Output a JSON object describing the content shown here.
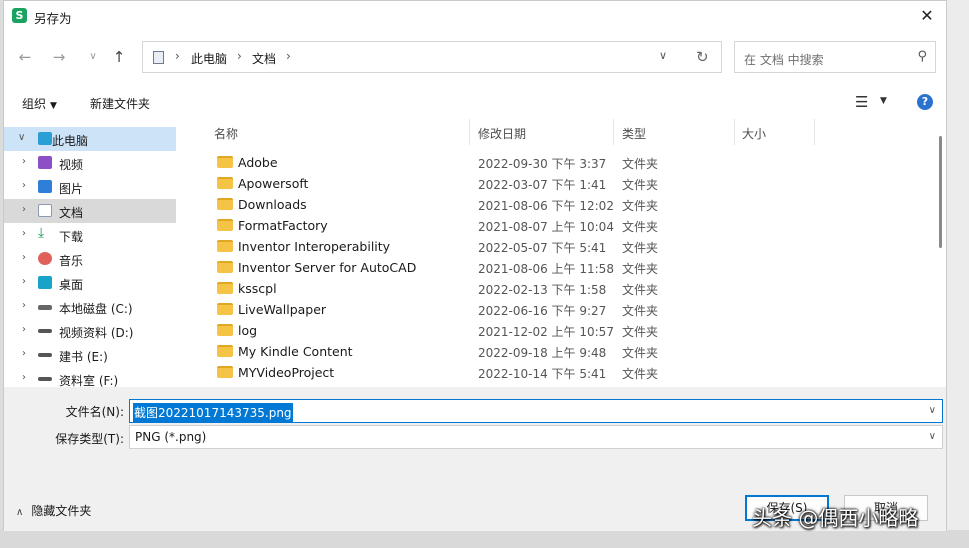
{
  "window": {
    "title": "另存为",
    "app_icon_glyph": "S",
    "close_glyph": "✕"
  },
  "address": {
    "crumbs": [
      "此电脑",
      "文档"
    ],
    "search_placeholder": "在 文档 中搜索"
  },
  "toolbar": {
    "organize_label": "组织",
    "new_folder_label": "新建文件夹"
  },
  "tree": {
    "items": [
      {
        "label": "此电脑",
        "icon": "computer-icon",
        "color": "#2a9fd6"
      },
      {
        "label": "视频",
        "icon": "video-icon",
        "color": "#8e4ec6"
      },
      {
        "label": "图片",
        "icon": "picture-icon",
        "color": "#2f7ed8"
      },
      {
        "label": "文档",
        "icon": "document-icon",
        "color": "#8a9bb2"
      },
      {
        "label": "下载",
        "icon": "download-icon",
        "color": "#1a9e5a"
      },
      {
        "label": "音乐",
        "icon": "music-icon",
        "color": "#e0605a"
      },
      {
        "label": "桌面",
        "icon": "desktop-icon",
        "color": "#19a3c9"
      },
      {
        "label": "本地磁盘 (C:)",
        "icon": "drive-icon",
        "color": "#555555"
      },
      {
        "label": "视频资料 (D:)",
        "icon": "drive-icon",
        "color": "#555555"
      },
      {
        "label": "建书 (E:)",
        "icon": "drive-icon",
        "color": "#555555"
      },
      {
        "label": "资料室 (F:)",
        "icon": "drive-icon",
        "color": "#555555"
      }
    ]
  },
  "columns": {
    "name": "名称",
    "modified": "修改日期",
    "type": "类型",
    "size": "大小"
  },
  "files": [
    {
      "name": "Adobe",
      "date": "2022-09-30 下午 3:37",
      "type": "文件夹"
    },
    {
      "name": "Apowersoft",
      "date": "2022-03-07 下午 1:41",
      "type": "文件夹"
    },
    {
      "name": "Downloads",
      "date": "2021-08-06 下午 12:02",
      "type": "文件夹"
    },
    {
      "name": "FormatFactory",
      "date": "2021-08-07 上午 10:04",
      "type": "文件夹"
    },
    {
      "name": "Inventor Interoperability",
      "date": "2022-05-07 下午 5:41",
      "type": "文件夹"
    },
    {
      "name": "Inventor Server for AutoCAD",
      "date": "2021-08-06 上午 11:58",
      "type": "文件夹"
    },
    {
      "name": "ksscpl",
      "date": "2022-02-13 下午 1:58",
      "type": "文件夹"
    },
    {
      "name": "LiveWallpaper",
      "date": "2022-06-16 下午 9:27",
      "type": "文件夹"
    },
    {
      "name": "log",
      "date": "2021-12-02 上午 10:57",
      "type": "文件夹"
    },
    {
      "name": "My Kindle Content",
      "date": "2022-09-18 上午 9:48",
      "type": "文件夹"
    },
    {
      "name": "MYVideoProject",
      "date": "2022-10-14 下午 5:41",
      "type": "文件夹"
    }
  ],
  "form": {
    "filename_label": "文件名(N):",
    "filename_value": "截图20221017143735.png",
    "filetype_label": "保存类型(T):",
    "filetype_value": "PNG (*.png)",
    "hide_folders_label": "隐藏文件夹",
    "save_label": "保存(S)",
    "cancel_label": "取消"
  },
  "watermark": "头条 @偶西小略略",
  "colors": {
    "accent": "#0078d4",
    "selected_tree": "#cde3f7",
    "folder": "#f5c446"
  }
}
